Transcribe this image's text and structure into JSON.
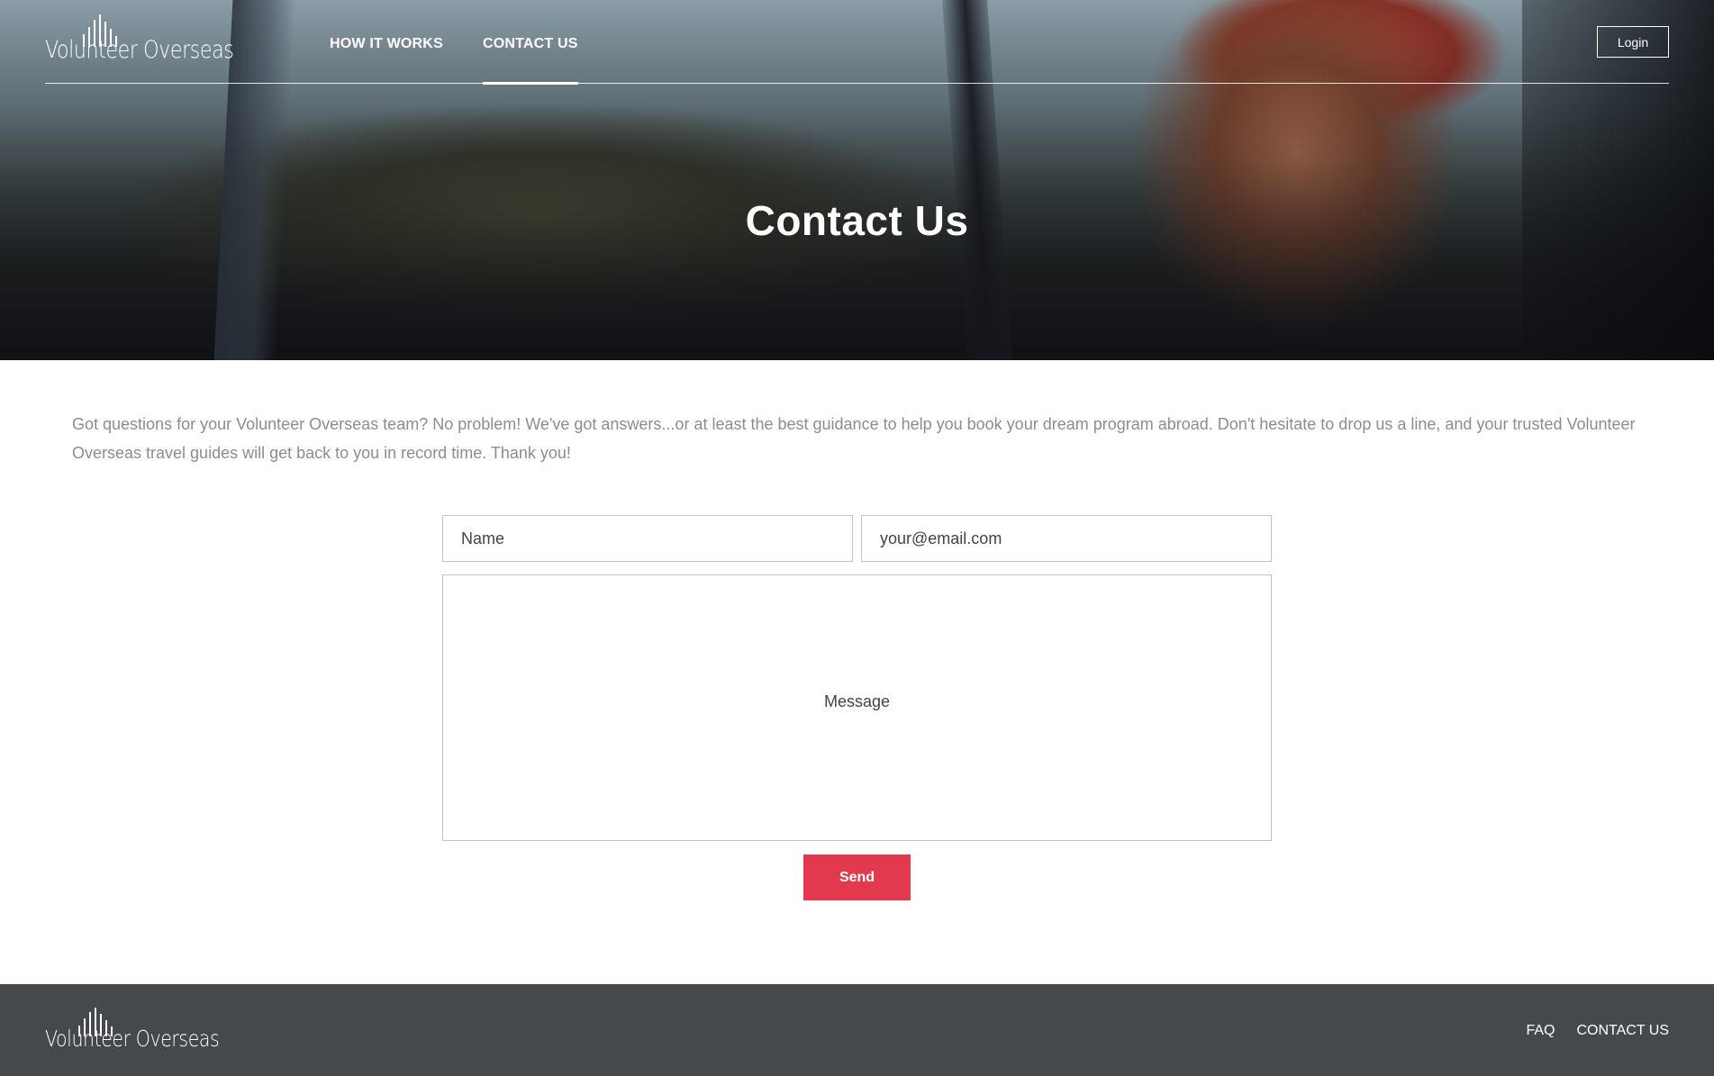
{
  "brand": {
    "name": "Volunteer Overseas"
  },
  "nav": {
    "links": [
      {
        "label": "HOW IT WORKS",
        "active": false
      },
      {
        "label": "CONTACT US",
        "active": true
      }
    ],
    "login_label": "Login"
  },
  "hero": {
    "title": "Contact Us"
  },
  "intro": {
    "text": "Got questions for your Volunteer Overseas team? No problem! We've got answers...or at least the best guidance to help you book your dream program abroad. Don't hesitate to drop us a line, and your trusted Volunteer Overseas travel guides will get back to you in record time. Thank you!"
  },
  "form": {
    "name_placeholder": "Name",
    "email_placeholder": "your@email.com",
    "message_placeholder": "Message",
    "send_label": "Send"
  },
  "footer": {
    "links": [
      {
        "label": "FAQ"
      },
      {
        "label": "CONTACT US"
      }
    ]
  },
  "colors": {
    "accent": "#e3394f",
    "footer_bg": "#45494b",
    "intro_text": "#8a8d90",
    "border": "#c4c4c4"
  }
}
